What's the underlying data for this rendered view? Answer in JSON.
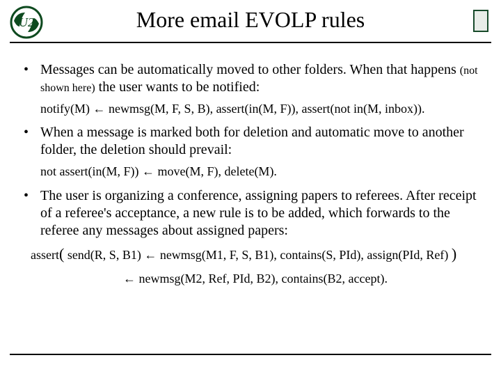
{
  "title": "More email EVOLP rules",
  "bullets": {
    "b1": "Messages can be automatically moved to other folders. When that happens ",
    "b1_small": "(not shown here)",
    "b1_cont": " the user wants to be notified:",
    "code1": "notify(M) ← newmsg(M, F, S, B), assert(in(M, F)), assert(not in(M, inbox)).",
    "b2": "When a message is marked both for deletion and automatic move to another folder, the deletion should prevail:",
    "code2": "not assert(in(M, F)) ← move(M, F), delete(M).",
    "b3": "The user is organizing a conference, assigning papers to referees. After receipt of a referee's acceptance, a new rule is to be added, which forwards to the referee any messages about assigned papers:",
    "code3a_pre": "assert",
    "code3a_mid": " send(R, S, B1) ← newmsg(M1, F, S, B1), contains(S, PId), assign(PId, Ref) ",
    "code3b": "← newmsg(M2, Ref, PId, B2), contains(B2, accept)."
  }
}
